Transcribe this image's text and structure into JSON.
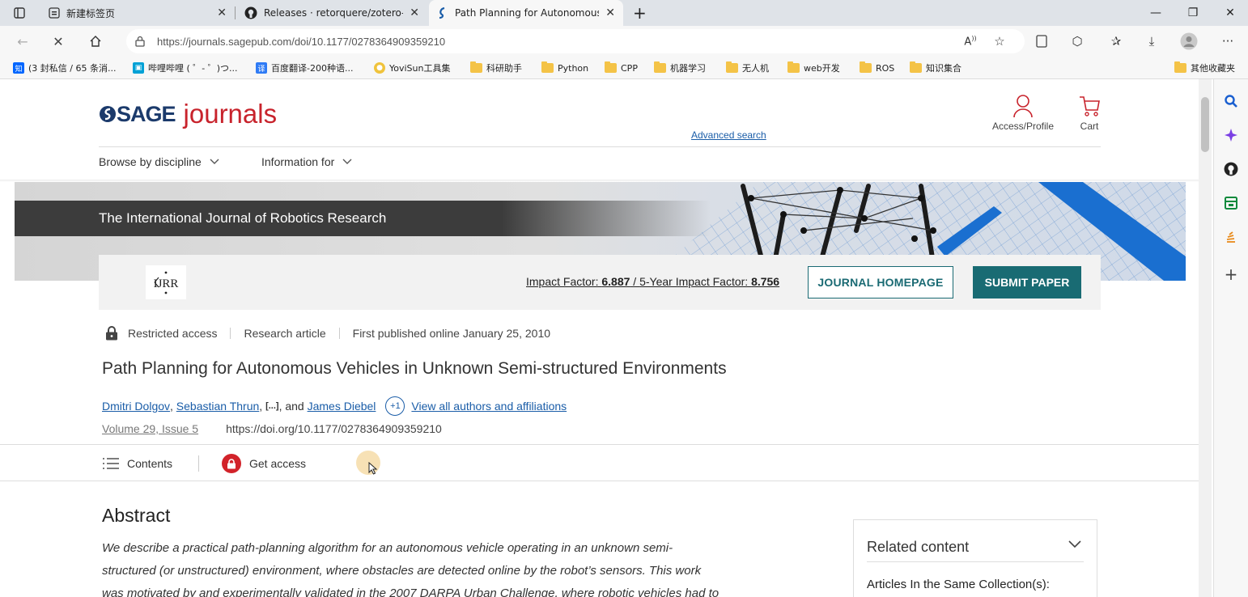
{
  "tabs": [
    {
      "title": "新建标签页",
      "icon": "new-tab-page-icon"
    },
    {
      "title": "Releases · retorquere/zotero-bet",
      "icon": "github-icon"
    },
    {
      "title": "Path Planning for Autonomous V",
      "icon": "sage-favicon-icon",
      "active": true
    }
  ],
  "address": {
    "url": "https://journals.sagepub.com/doi/10.1177/0278364909359210"
  },
  "bookmarks": [
    {
      "label": "(3 封私信 / 65 条消...",
      "icon": "zhihu-icon"
    },
    {
      "label": "哔哩哔哩 ( ゜- ゜)つ...",
      "icon": "bilibili-icon"
    },
    {
      "label": "百度翻译-200种语...",
      "icon": "baidu-translate-icon"
    },
    {
      "label": "YoviSun工具集",
      "icon": "yovisun-icon"
    },
    {
      "label": "科研助手",
      "icon": "folder-icon"
    },
    {
      "label": "Python",
      "icon": "folder-icon"
    },
    {
      "label": "CPP",
      "icon": "folder-icon"
    },
    {
      "label": "机器学习",
      "icon": "folder-icon"
    },
    {
      "label": "无人机",
      "icon": "folder-icon"
    },
    {
      "label": "web开发",
      "icon": "folder-icon"
    },
    {
      "label": "ROS",
      "icon": "folder-icon"
    },
    {
      "label": "知识集合",
      "icon": "folder-icon"
    },
    {
      "label": "其他收藏夹",
      "icon": "folder-icon"
    }
  ],
  "header": {
    "logo_left": "SAGE",
    "logo_right": "journals",
    "access_label": "Access/Profile",
    "cart_label": "Cart",
    "advanced_search": "Advanced search",
    "nav": [
      "Browse by discipline",
      "Information for"
    ]
  },
  "journal": {
    "name": "The International Journal of Robotics Research",
    "abbr": "IJRR",
    "impact_label": "Impact Factor: ",
    "impact_value": "6.887",
    "impact_sep": " / ",
    "five_year_label": "5-Year Impact Factor: ",
    "five_year_value": "8.756",
    "homepage_btn": "JOURNAL HOMEPAGE",
    "submit_btn": "SUBMIT PAPER"
  },
  "article": {
    "access": "Restricted access",
    "type": "Research article",
    "published": "First published online January 25, 2010",
    "title": "Path Planning for Autonomous Vehicles in Unknown Semi-structured Environments",
    "author1": "Dmitri Dolgov",
    "author2": "Sebastian Thrun",
    "ellipsis": "[...]",
    "and": "and",
    "author3": "James Diebel",
    "more_count": "+1",
    "view_all": "View all authors and affiliations",
    "volume": "Volume 29, Issue 5",
    "doi": "https://doi.org/10.1177/0278364909359210"
  },
  "strip": {
    "contents": "Contents",
    "get_access": "Get access"
  },
  "abstract": {
    "heading": "Abstract",
    "line1": "We describe a practical path-planning algorithm for an autonomous vehicle operating in an unknown semi-",
    "line2": "structured (or unstructured) environment, where obstacles are detected online by the robot’s sensors. This work",
    "line3": "was motivated by and experimentally validated in the 2007 DARPA Urban Challenge, where robotic vehicles had to"
  },
  "related": {
    "heading": "Related content",
    "sub": "Articles In the Same Collection(s):"
  },
  "colors": {
    "teal": "#196b73",
    "sage_red": "#c8232c",
    "sage_blue": "#1b3a6b",
    "link": "#1a5da8"
  }
}
